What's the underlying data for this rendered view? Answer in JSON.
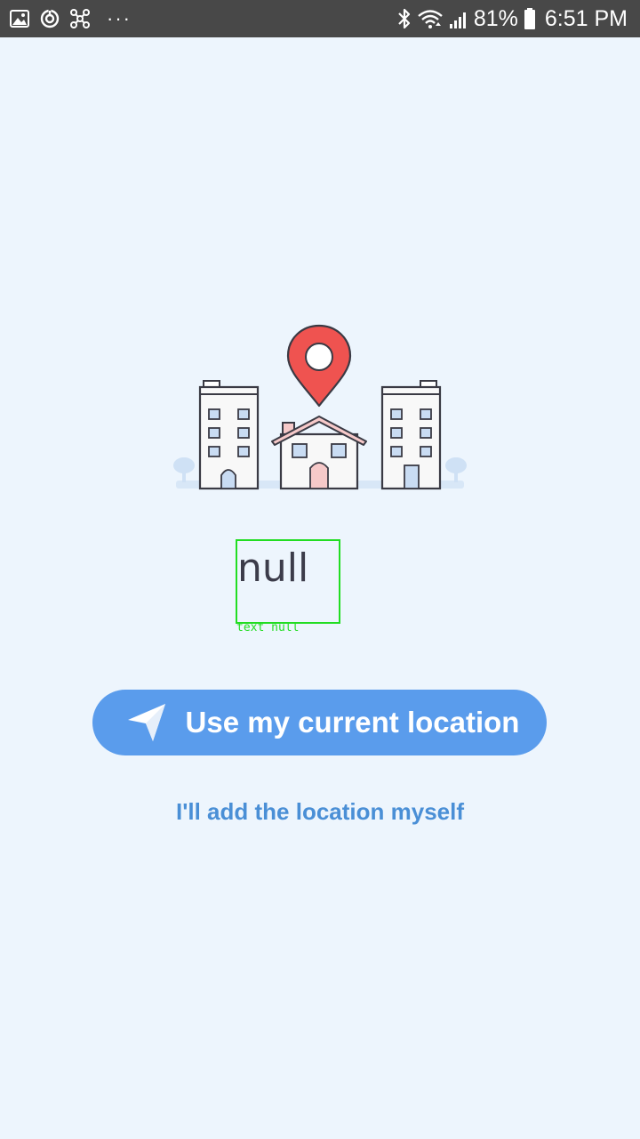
{
  "status_bar": {
    "left_icons": [
      "gallery-icon",
      "sync-icon",
      "network-icon"
    ],
    "more_indicator": "···",
    "right_icons": [
      "bluetooth-icon",
      "wifi-icon",
      "signal-icon",
      "battery-icon"
    ],
    "battery_percent": "81%",
    "time": "6:51 PM"
  },
  "illustration": {
    "icon": "city-location-pin-illustration",
    "pin_color": "#ef5350"
  },
  "main": {
    "title_text": "null",
    "debug_label": "text null"
  },
  "actions": {
    "primary_label": "Use my current location",
    "primary_icon": "navigation-arrow-icon",
    "primary_color": "#5a9cec",
    "secondary_label": "I'll add the location myself",
    "secondary_color": "#4a8fd6"
  }
}
